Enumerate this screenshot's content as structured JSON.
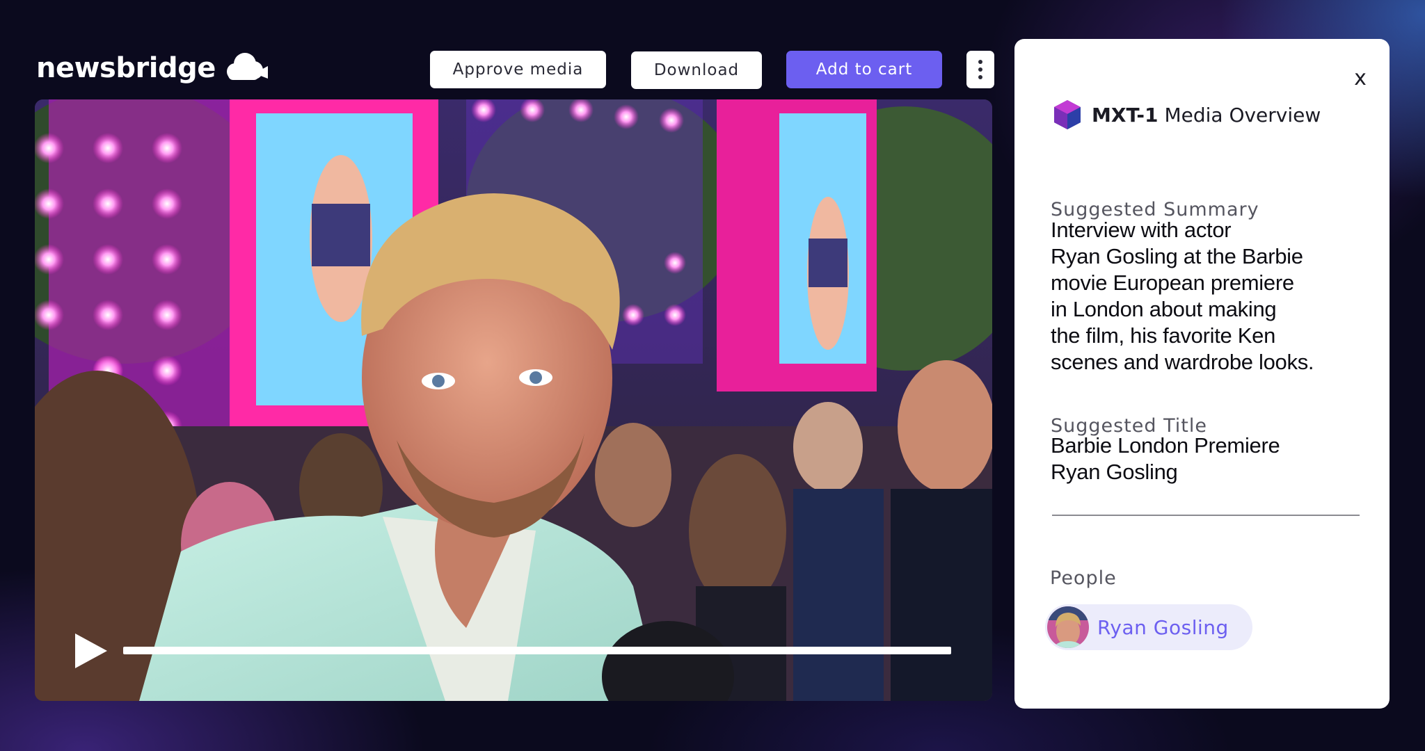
{
  "brand": {
    "name": "newsbridge",
    "icon": "camera-cloud-icon"
  },
  "toolbar": {
    "approve_label": "Approve media",
    "download_label": "Download",
    "add_to_cart_label": "Add to cart",
    "more_icon": "more-vertical-icon"
  },
  "colors": {
    "accent": "#6c5ff0",
    "chip_background": "#ececfb",
    "page_background": "#0b0a1e"
  },
  "player": {
    "play_icon": "play-icon",
    "progress": 0
  },
  "panel": {
    "close_label": "x",
    "header": {
      "model": "MXT-1",
      "title": "Media Overview",
      "icon": "cube-icon"
    },
    "summary": {
      "label": "Suggested Summary",
      "lines": [
        "Interview with actor",
        "Ryan Gosling at the Barbie",
        "movie European premiere",
        "in London about making",
        "the film, his favorite Ken",
        "scenes and wardrobe looks."
      ]
    },
    "title": {
      "label": "Suggested Title",
      "lines": [
        "Barbie London Premiere",
        "Ryan Gosling"
      ]
    },
    "people": {
      "label": "People",
      "items": [
        {
          "name": "Ryan Gosling"
        }
      ]
    }
  }
}
